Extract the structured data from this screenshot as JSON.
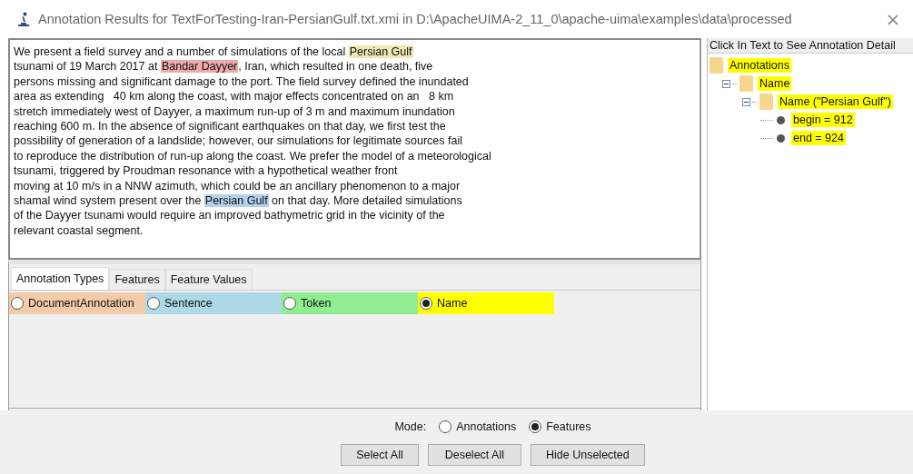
{
  "window": {
    "title": "Annotation Results for TextForTesting-Iran-PersianGulf.txt.xmi in D:\\ApacheUIMA-2_11_0\\apache-uima\\examples\\data\\processed",
    "close": "×"
  },
  "document": {
    "lines": [
      [
        {
          "text": "We present a field survey and a number of simulations of the local "
        },
        {
          "text": "Persian Gulf",
          "color": "#eee8b4"
        }
      ],
      [
        {
          "text": "tsunami of 19 March 2017 at "
        },
        {
          "text": "Bandar Dayyer",
          "color": "#eeaaa8"
        },
        {
          "text": ", Iran, which resulted in one death, five"
        }
      ],
      [
        {
          "text": "persons missing and significant damage to the port. The field survey defined the inundated"
        }
      ],
      [
        {
          "text": "area as extending   40 km along the coast, with major effects concentrated on an   8 km"
        }
      ],
      [
        {
          "text": "stretch immediately west of Dayyer, a maximum run-up of 3 m and maximum inundation"
        }
      ],
      [
        {
          "text": "reaching 600 m. In the absence of significant earthquakes on that day, we first test the"
        }
      ],
      [
        {
          "text": "possibility of generation of a landslide; however, our simulations for legitimate sources fail"
        }
      ],
      [
        {
          "text": "to reproduce the distribution of run-up along the coast. We prefer the model of a meteorological"
        }
      ],
      [
        {
          "text": "tsunami, triggered by Proudman resonance with a hypothetical weather front"
        }
      ],
      [
        {
          "text": "moving at 10 m/s in a NNW azimuth, which could be an ancillary phenomenon to a major"
        }
      ],
      [
        {
          "text": "shamal wind system present over the "
        },
        {
          "text": "Persian Gulf",
          "color": "#b3d0ec"
        },
        {
          "text": " on that day. More detailed simulations"
        }
      ],
      [
        {
          "text": "of the Dayyer tsunami would require an improved bathymetric grid in the vicinity of the"
        }
      ],
      [
        {
          "text": "relevant coastal segment."
        }
      ]
    ]
  },
  "tabs": [
    {
      "label": "Annotation Types",
      "selected": true
    },
    {
      "label": "Features",
      "selected": false
    },
    {
      "label": "Feature Values",
      "selected": false
    }
  ],
  "annotation_types": [
    {
      "label": "DocumentAnnotation",
      "color": "#f3cba9",
      "selected": false
    },
    {
      "label": "Sentence",
      "color": "#add8e6",
      "selected": false
    },
    {
      "label": "Token",
      "color": "#90ee90",
      "selected": false
    },
    {
      "label": "Name",
      "color": "#ffff00",
      "selected": true
    }
  ],
  "tree": {
    "header": "Click In Text to See Annotation Detail",
    "items": [
      {
        "label": "Annotations",
        "kind": "folder",
        "children": [
          {
            "label": "Name",
            "kind": "folder",
            "expanded": true,
            "children": [
              {
                "label": "Name (\"Persian Gulf\")",
                "kind": "folder",
                "expanded": true,
                "children": [
                  {
                    "label": "begin = 912",
                    "kind": "leaf"
                  },
                  {
                    "label": "end = 924",
                    "kind": "leaf"
                  }
                ]
              }
            ]
          }
        ]
      }
    ]
  },
  "mode": {
    "label": "Mode:",
    "options": [
      {
        "label": "Annotations",
        "selected": false
      },
      {
        "label": "Features",
        "selected": true
      }
    ]
  },
  "buttons": [
    "Select All",
    "Deselect All",
    "Hide Unselected"
  ]
}
